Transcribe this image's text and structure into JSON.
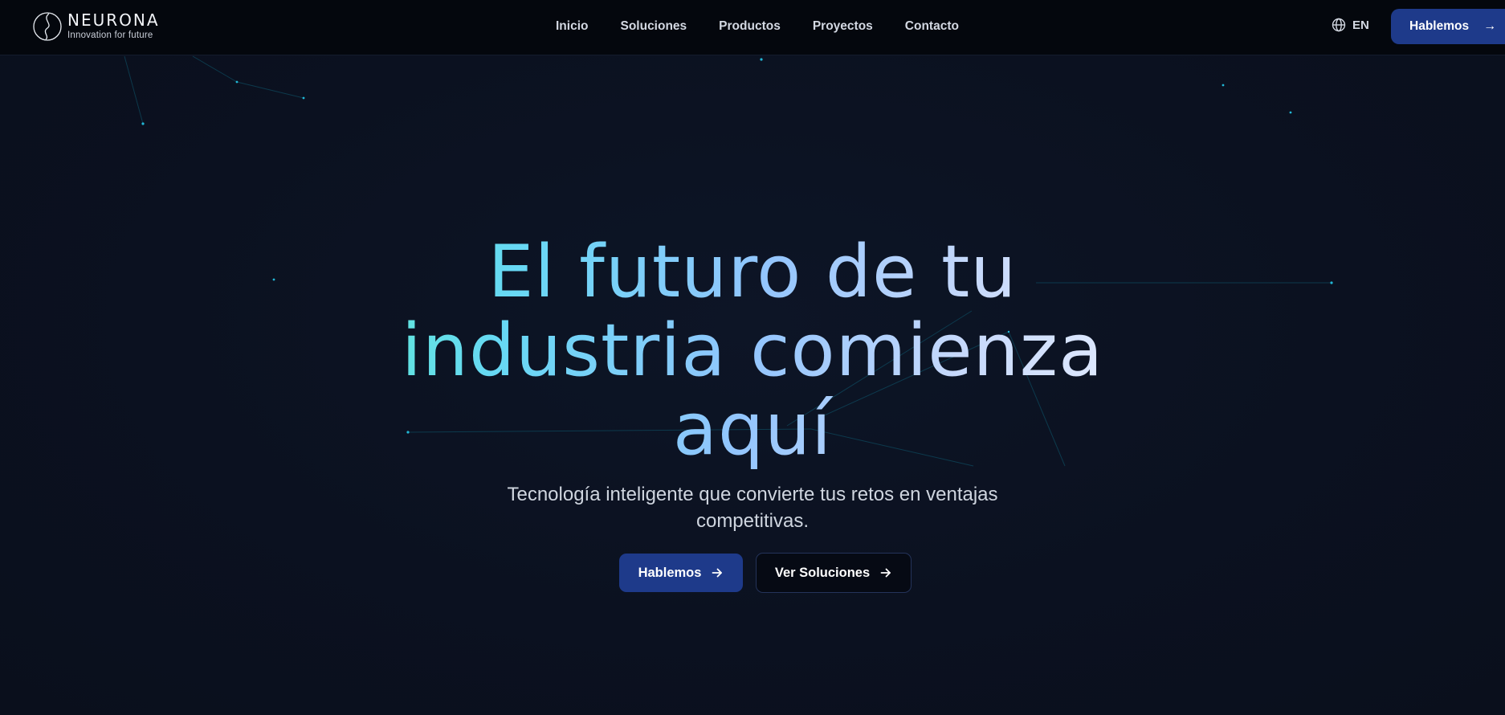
{
  "brand": {
    "name": "NEURONA",
    "tagline": "Innovation for future"
  },
  "nav": {
    "items": [
      {
        "label": "Inicio"
      },
      {
        "label": "Soluciones"
      },
      {
        "label": "Productos"
      },
      {
        "label": "Proyectos"
      },
      {
        "label": "Contacto"
      }
    ]
  },
  "header": {
    "language": "EN",
    "language_icon": "globe-icon",
    "cta_label": "Hablemos",
    "cta_arrow": "→"
  },
  "hero": {
    "title_lines": [
      "El futuro de tu",
      "industria comienza",
      "aquí"
    ],
    "subtitle": "Tecnología inteligente que convierte tus retos en ventajas competitivas.",
    "primary_button": "Hablemos",
    "secondary_button": "Ver Soluciones",
    "button_icon": "arrow-right-icon"
  },
  "colors": {
    "background": "#0b1120",
    "header_background": "#04070d",
    "accent": "#1e3a8a",
    "gradient_start": "#5eead4",
    "gradient_end": "#e8efff",
    "network_lines": "#0e7490"
  }
}
